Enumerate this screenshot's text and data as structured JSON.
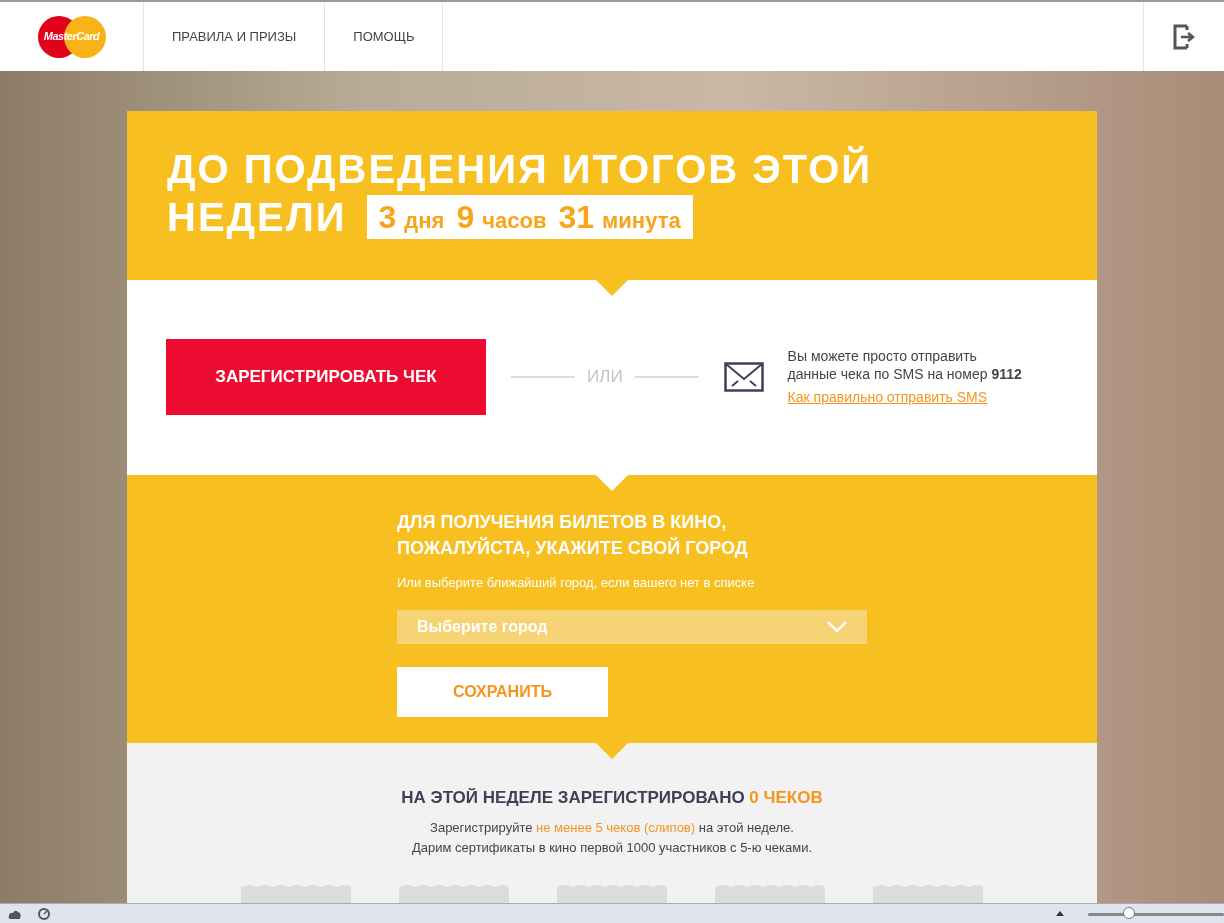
{
  "logo_text": "MasterCard",
  "nav": {
    "items": [
      {
        "label": "ПРАВИЛА И ПРИЗЫ"
      },
      {
        "label": "ПОМОЩЬ"
      }
    ]
  },
  "countdown": {
    "title_line1": "ДО ПОДВЕДЕНИЯ ИТОГОВ ЭТОЙ",
    "title_line2": "НЕДЕЛИ",
    "units": [
      {
        "value": "3",
        "unit": "дня"
      },
      {
        "value": "9",
        "unit": "часов"
      },
      {
        "value": "31",
        "unit": "минута"
      }
    ]
  },
  "register": {
    "button": "ЗАРЕГИСТРИРОВАТЬ ЧЕК",
    "or": "ИЛИ",
    "sms_text": "Вы можете просто отправить данные чека по SMS на номер **9112**",
    "sms_link": "Как правильно отправить SMS"
  },
  "city": {
    "title": "ДЛЯ ПОЛУЧЕНИЯ БИЛЕТОВ В КИНО, ПОЖАЛУЙСТА, УКАЖИТЕ СВОЙ ГОРОД",
    "hint": "Или выберите ближайший город, если вашего нет в списке",
    "select_placeholder": "Выберите город",
    "save": "СОХРАНИТЬ"
  },
  "stats": {
    "heading": [
      {
        "text": "НА ЭТОЙ НЕДЕЛЕ ЗАРЕГИСТРИРОВАНО ",
        "highlight": false
      },
      {
        "text": "0 ЧЕКОВ",
        "highlight": true
      }
    ],
    "line1": [
      {
        "text": "Зарегистрируйте ",
        "highlight": false
      },
      {
        "text": "не менее 5 чеков (слипов)",
        "highlight": true
      },
      {
        "text": " на этой неделе.",
        "highlight": false
      }
    ],
    "line2": "Дарим сертификаты в кино первой 1000 участников с 5-ю чеками."
  },
  "status_bar": {
    "zoom": {
      "level": 0.3
    }
  }
}
